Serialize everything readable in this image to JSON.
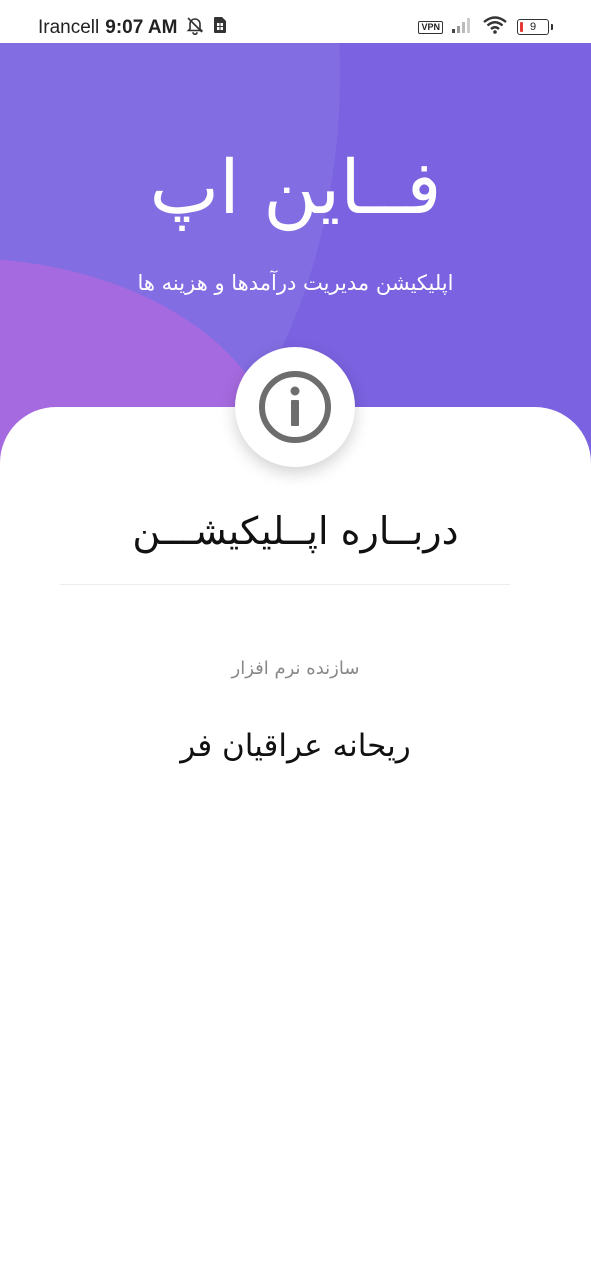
{
  "status_bar": {
    "carrier": "Irancell",
    "time": "9:07 AM",
    "vpn": "VPN",
    "battery": "9",
    "icons": [
      "alarm-off-icon",
      "sim-icon",
      "signal-icon",
      "wifi-icon",
      "battery-icon"
    ],
    "battery_color": "#e53935"
  },
  "header": {
    "title": "فــاین اپ",
    "subtitle": "اپلیکیشن مدیریت درآمدها و هزینه ها",
    "background": "#7a62e0",
    "accent": "#a66ae0"
  },
  "about": {
    "icon": "info-icon",
    "title": "دربــاره اپــلیکیشـــن",
    "developer_label": "سازنده نرم افزار",
    "developer_name": "ریحانه عراقیان فر"
  }
}
